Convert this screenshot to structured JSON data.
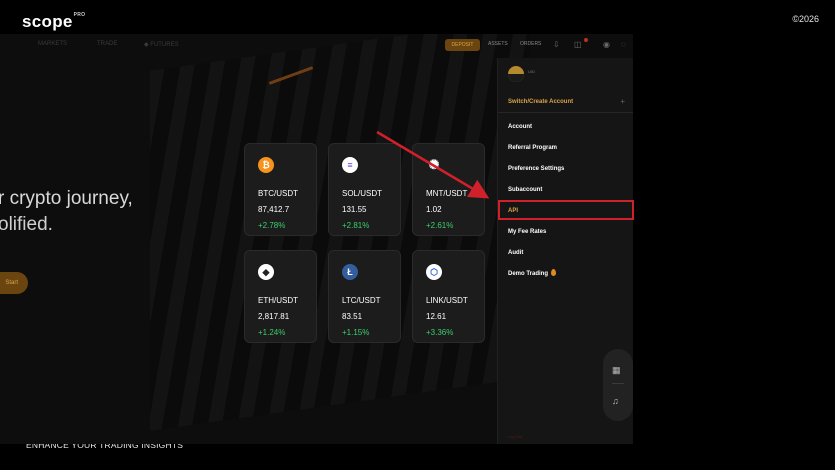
{
  "brand": {
    "name": "scope",
    "mark": "PRO"
  },
  "copyright": "©2026",
  "footer_tagline": "ENHANCE YOUR TRADING INSIGHTS",
  "hero": {
    "line1": "r crypto journey,",
    "line2": "olified.",
    "cta": "Start"
  },
  "nav": {
    "items": [
      "MARKETS",
      "TRADE",
      "◆ FUTURES"
    ],
    "deposit": "DEPOSIT",
    "assets": "ASSETS",
    "orders": "ORDERS"
  },
  "cards": [
    {
      "pair": "BTC/USDT",
      "price": "87,412.7",
      "change": "+2.78%",
      "icon": "bitcoin-icon",
      "symbol": "₿",
      "color": "#f7931a"
    },
    {
      "pair": "SOL/USDT",
      "price": "131.55",
      "change": "+2.81%",
      "icon": "solana-icon",
      "symbol": "≡",
      "color": "#ffffff"
    },
    {
      "pair": "MNT/USDT",
      "price": "1.02",
      "change": "+2.61%",
      "icon": "mantle-icon",
      "symbol": "✺",
      "color": "#1c1c1c"
    },
    {
      "pair": "ETH/USDT",
      "price": "2,817.81",
      "change": "+1.24%",
      "icon": "ethereum-icon",
      "symbol": "◆",
      "color": "#ffffff"
    },
    {
      "pair": "LTC/USDT",
      "price": "83.51",
      "change": "+1.15%",
      "icon": "litecoin-icon",
      "symbol": "Ł",
      "color": "#345d9d"
    },
    {
      "pair": "LINK/USDT",
      "price": "12.61",
      "change": "+3.36%",
      "icon": "chainlink-icon",
      "symbol": "⬡",
      "color": "#ffffff"
    }
  ],
  "menu": {
    "avatar_tag": "UID",
    "switch_account": "Switch/Create Account",
    "items": [
      "Account",
      "Referral Program",
      "Preference Settings",
      "Subaccount",
      "API",
      "My Fee Rates",
      "Audit",
      "Demo Trading"
    ],
    "active": "API",
    "footer": "Log Out"
  },
  "colors": {
    "accent": "#d9a34a",
    "highlight": "#d0202a",
    "positive": "#3ccf6e"
  }
}
